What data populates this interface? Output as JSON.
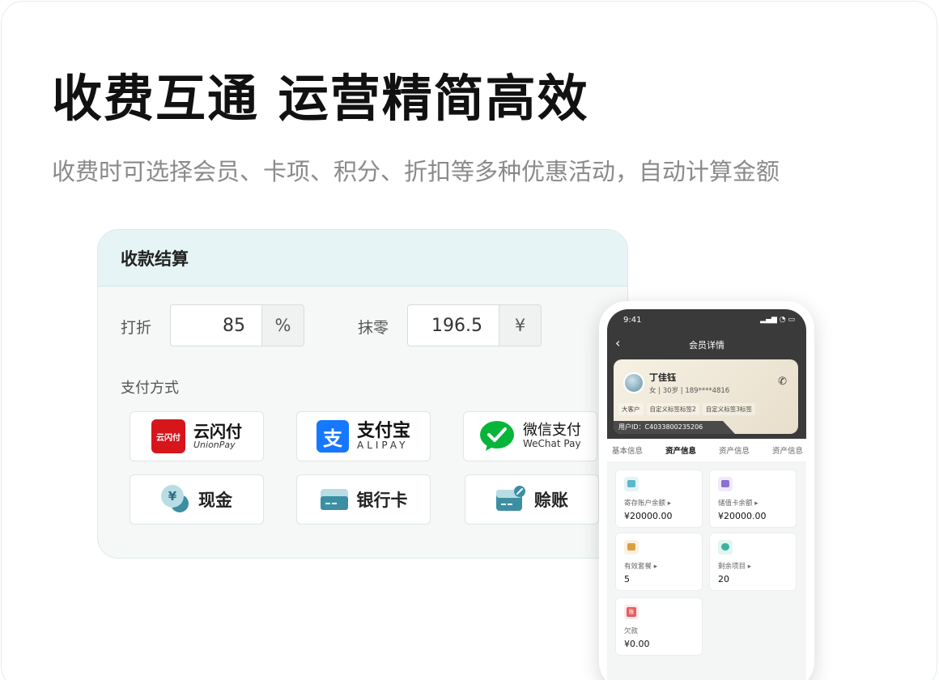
{
  "hero": {
    "title": "收费互通 运营精简高效",
    "subtitle": "收费时可选择会员、卡项、积分、折扣等多种优惠活动，自动计算金额"
  },
  "payment_panel": {
    "title": "收款结算",
    "discount": {
      "label": "打折",
      "value": "85",
      "unit": "%"
    },
    "rounding": {
      "label": "抹零",
      "value": "196.5",
      "unit": "¥"
    },
    "methods_label": "支付方式",
    "methods": [
      {
        "id": "unionpay",
        "name": "云闪付",
        "sub": "UnionPay",
        "icon_text": "云闪付"
      },
      {
        "id": "alipay",
        "name": "支付宝",
        "sub": "ALIPAY",
        "icon_text": "支"
      },
      {
        "id": "wechat",
        "name": "微信支付",
        "sub": "WeChat Pay"
      },
      {
        "id": "cash",
        "name": "现金",
        "icon_text": "¥"
      },
      {
        "id": "bankcard",
        "name": "银行卡"
      },
      {
        "id": "credit",
        "name": "赊账"
      }
    ]
  },
  "phone": {
    "status_time": "9:41",
    "nav_title": "会员详情",
    "member": {
      "name": "丁佳钰",
      "info": "女 | 30岁 | 189****4816",
      "tags": [
        "大客户",
        "自定义标签标签2",
        "自定义标签3标签"
      ],
      "user_id": "用户ID：C4033800235206"
    },
    "tabs": [
      "基本信息",
      "资产信息",
      "资产信息",
      "资产信息"
    ],
    "assets": [
      {
        "label": "寄存账户余额",
        "value": "¥20000.00",
        "color": "#5bb8c9"
      },
      {
        "label": "储值卡余额",
        "value": "¥20000.00",
        "color": "#8a6fd6"
      },
      {
        "label": "有效套餐",
        "value": "5",
        "color": "#d8a040"
      },
      {
        "label": "剩余项目",
        "value": "20",
        "color": "#3bb39a"
      },
      {
        "label": "欠款",
        "value": "¥0.00",
        "color": "#e35d5d",
        "icon_text": "账"
      }
    ]
  },
  "colors": {
    "header_teal": "#e6f4f5",
    "unionpay_red": "#d7161c",
    "alipay_blue": "#1677ff",
    "wechat_green": "#07b53b",
    "icon_teal": "#3c8fa3"
  }
}
